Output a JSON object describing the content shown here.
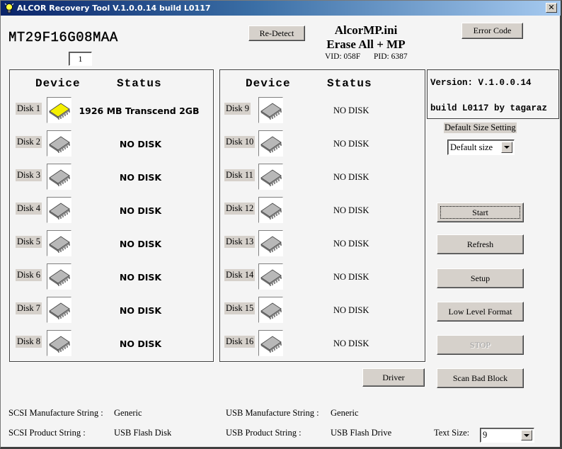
{
  "window": {
    "title": "ALCOR Recovery Tool V.1.0.0.14 build L0117",
    "close_label": "✕"
  },
  "header": {
    "chip_name": "MT29F16G08MAA",
    "index_value": "1",
    "redetect_label": "Re-Detect",
    "ini_file": "AlcorMP.ini",
    "mode": "Erase All + MP",
    "vid": "VID: 058F",
    "pid": "PID: 6387",
    "error_code_label": "Error Code"
  },
  "panels": {
    "device_header": "Device",
    "status_header": "Status",
    "left": [
      {
        "label": "Disk 1",
        "status": "1926 MB Transcend 2GB",
        "active": true
      },
      {
        "label": "Disk 2",
        "status": "NO DISK",
        "active": false
      },
      {
        "label": "Disk 3",
        "status": "NO DISK",
        "active": false
      },
      {
        "label": "Disk 4",
        "status": "NO DISK",
        "active": false
      },
      {
        "label": "Disk 5",
        "status": "NO DISK",
        "active": false
      },
      {
        "label": "Disk 6",
        "status": "NO DISK",
        "active": false
      },
      {
        "label": "Disk 7",
        "status": "NO DISK",
        "active": false
      },
      {
        "label": "Disk 8",
        "status": "NO DISK",
        "active": false
      }
    ],
    "right": [
      {
        "label": "Disk 9",
        "status": "NO DISK",
        "active": false
      },
      {
        "label": "Disk 10",
        "status": "NO DISK",
        "active": false
      },
      {
        "label": "Disk 11",
        "status": "NO DISK",
        "active": false
      },
      {
        "label": "Disk 12",
        "status": "NO DISK",
        "active": false
      },
      {
        "label": "Disk 13",
        "status": "NO DISK",
        "active": false
      },
      {
        "label": "Disk 14",
        "status": "NO DISK",
        "active": false
      },
      {
        "label": "Disk 15",
        "status": "NO DISK",
        "active": false
      },
      {
        "label": "Disk 16",
        "status": "NO DISK",
        "active": false
      }
    ]
  },
  "sidebar": {
    "version_line1": "Version: V.1.0.0.14",
    "version_line2": "build L0117 by tagaraz",
    "default_size_label": "Default Size Setting",
    "default_size_value": "Default size",
    "buttons": {
      "start": "Start",
      "refresh": "Refresh",
      "setup": "Setup",
      "low_level_format": "Low Level Format",
      "stop": "STOP",
      "scan_bad_block": "Scan Bad Block"
    },
    "driver": "Driver"
  },
  "footer": {
    "scsi_manufacture_label": "SCSI Manufacture String :",
    "scsi_manufacture_value": "Generic",
    "scsi_product_label": "SCSI Product String :",
    "scsi_product_value": "USB Flash Disk",
    "usb_manufacture_label": "USB Manufacture String :",
    "usb_manufacture_value": "Generic",
    "usb_product_label": "USB Product String :",
    "usb_product_value": "USB Flash Drive",
    "text_size_label": "Text Size:",
    "text_size_value": "9"
  },
  "colors": {
    "chip_active": "#f5f000",
    "chip_inactive": "#b8b8b8"
  }
}
